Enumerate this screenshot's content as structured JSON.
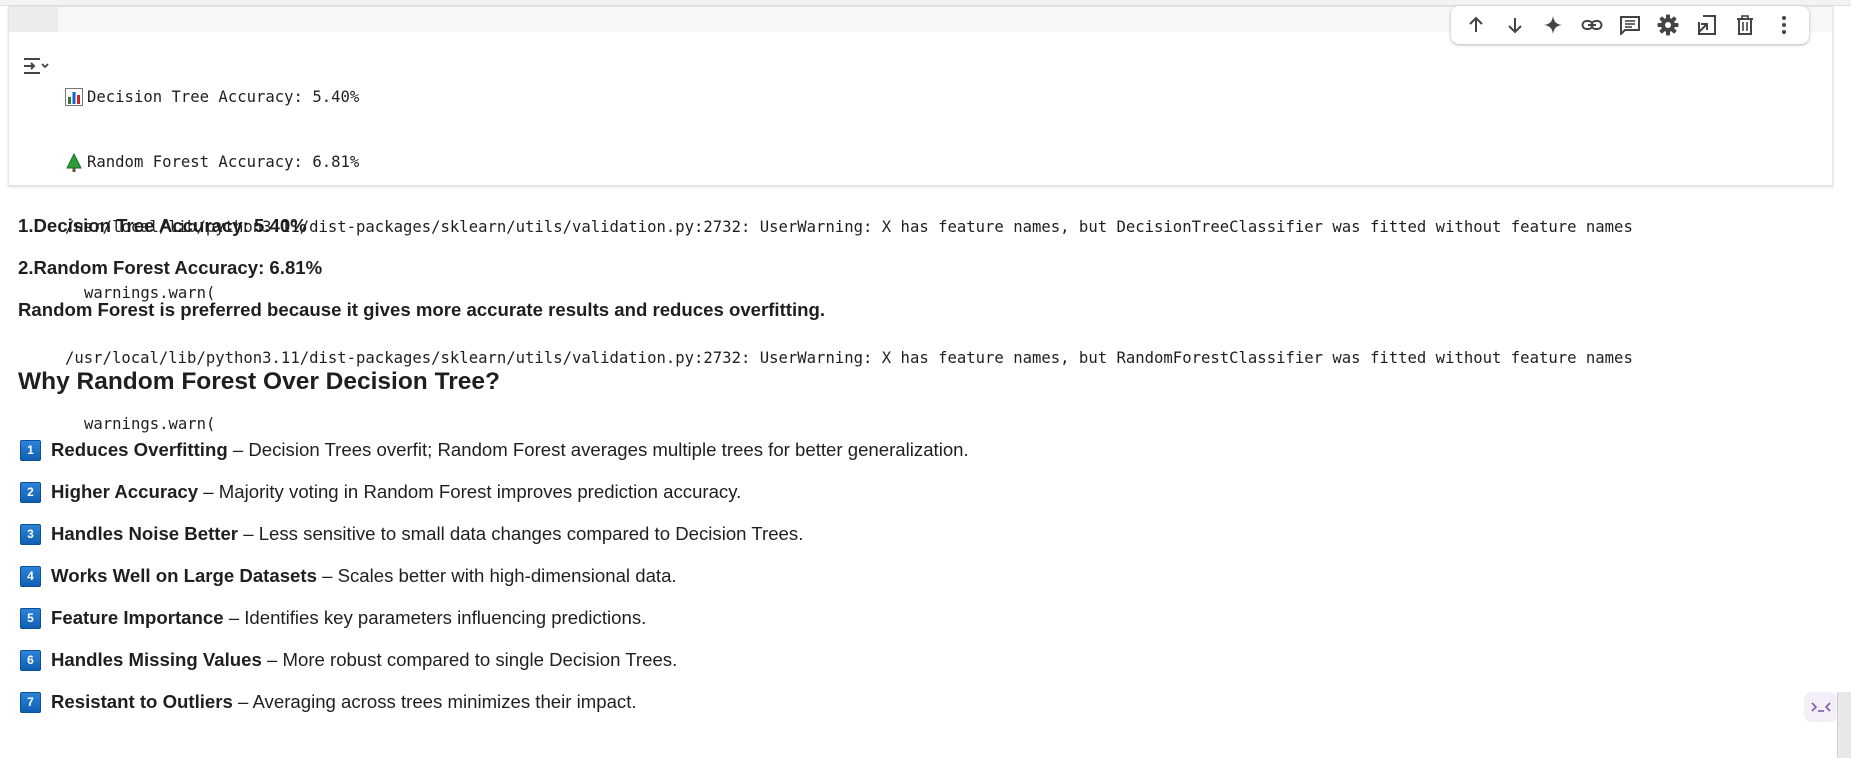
{
  "output": {
    "lines": [
      {
        "icon": "bar-chart-emoji",
        "text": "Decision Tree Accuracy: 5.40%"
      },
      {
        "icon": "evergreen-tree-emoji",
        "text": "Random Forest Accuracy: 6.81%"
      },
      {
        "text": "/usr/local/lib/python3.11/dist-packages/sklearn/utils/validation.py:2732: UserWarning: X has feature names, but DecisionTreeClassifier was fitted without feature names"
      },
      {
        "text": "warnings.warn("
      },
      {
        "text": "/usr/local/lib/python3.11/dist-packages/sklearn/utils/validation.py:2732: UserWarning: X has feature names, but RandomForestClassifier was fitted without feature names"
      },
      {
        "text": "warnings.warn("
      }
    ]
  },
  "toolbar": {
    "buttons": [
      {
        "icon": "arrow-up-icon"
      },
      {
        "icon": "arrow-down-icon"
      },
      {
        "icon": "sparkle-icon"
      },
      {
        "icon": "link-icon"
      },
      {
        "icon": "comment-icon"
      },
      {
        "icon": "gear-icon"
      },
      {
        "icon": "open-in-tab-icon"
      },
      {
        "icon": "trash-icon"
      },
      {
        "icon": "more-vertical-icon"
      }
    ]
  },
  "markdown": {
    "result1": "1.Decision Tree Accuracy: 5.40%",
    "result2": "2.Random Forest Accuracy: 6.81%",
    "conclusion": "Random Forest is preferred because it gives more accurate results and reduces overfitting.",
    "heading": "Why Random Forest Over Decision Tree?",
    "reasons": [
      {
        "num": "1",
        "title": "Reduces Overfitting",
        "desc": " – Decision Trees overfit; Random Forest averages multiple trees for better generalization."
      },
      {
        "num": "2",
        "title": "Higher Accuracy",
        "desc": " – Majority voting in Random Forest improves prediction accuracy."
      },
      {
        "num": "3",
        "title": "Handles Noise Better",
        "desc": " – Less sensitive to small data changes compared to Decision Trees."
      },
      {
        "num": "4",
        "title": "Works Well on Large Datasets",
        "desc": " – Scales better with high-dimensional data."
      },
      {
        "num": "5",
        "title": "Feature Importance",
        "desc": " – Identifies key parameters influencing predictions."
      },
      {
        "num": "6",
        "title": "Handles Missing Values",
        "desc": " – More robust compared to single Decision Trees."
      },
      {
        "num": "7",
        "title": "Resistant to Outliers",
        "desc": " – Averaging across trees minimizes their impact."
      }
    ]
  },
  "colors": {
    "accent_purple": "#7b5ea7",
    "number_badge": "#1a6fc8"
  }
}
